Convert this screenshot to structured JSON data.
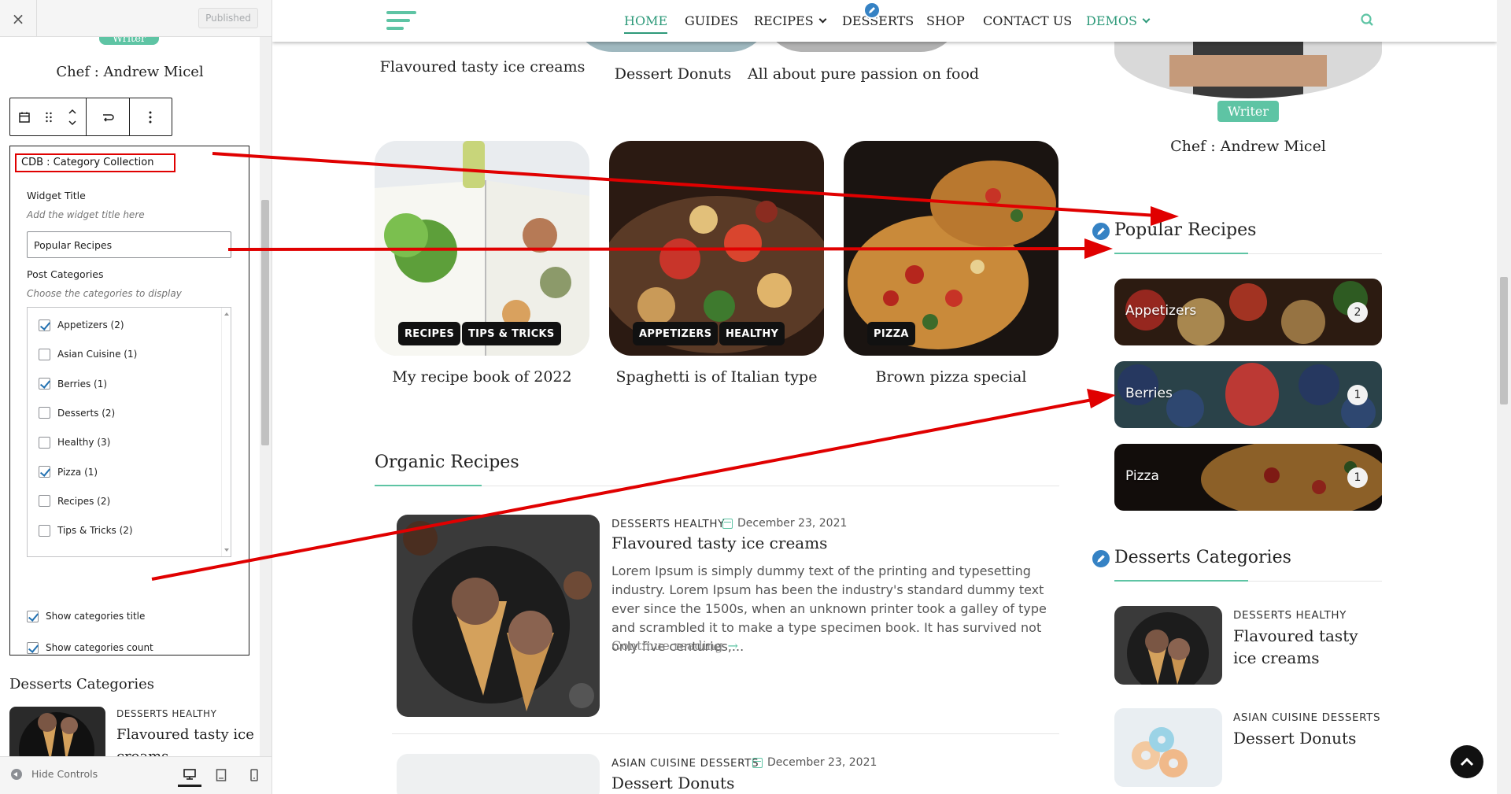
{
  "customizer": {
    "close_label": "×",
    "status_button": "Published",
    "writer_badge": "Writer",
    "chef_name": "Chef : Andrew Micel",
    "widget": {
      "name": "CDB : Category Collection",
      "widget_title_label": "Widget Title",
      "widget_title_help": "Add the widget title here",
      "widget_title_value": "Popular Recipes",
      "post_categories_label": "Post Categories",
      "post_categories_help": "Choose the categories to display",
      "categories": [
        {
          "label": "Appetizers (2)",
          "checked": true
        },
        {
          "label": "Asian Cuisine (1)",
          "checked": false
        },
        {
          "label": "Berries (1)",
          "checked": true
        },
        {
          "label": "Desserts (2)",
          "checked": false
        },
        {
          "label": "Healthy (3)",
          "checked": false
        },
        {
          "label": "Pizza (1)",
          "checked": true
        },
        {
          "label": "Recipes (2)",
          "checked": false
        },
        {
          "label": "Tips & Tricks (2)",
          "checked": false
        }
      ],
      "show_title_label": "Show categories title",
      "show_title_checked": true,
      "show_count_label": "Show categories count",
      "show_count_checked": true
    },
    "next_widget_title": "Desserts Categories",
    "next_post_cats": "DESSERTS  HEALTHY",
    "next_post_title": "Flavoured tasty ice creams",
    "hide_controls": "Hide Controls"
  },
  "nav": {
    "items": [
      "HOME",
      "GUIDES",
      "RECIPES",
      "DESSERTS",
      "SHOP",
      "CONTACT US",
      "DEMOS"
    ]
  },
  "top_row_titles": [
    "Flavoured tasty ice creams",
    "Dessert Donuts",
    "All about pure passion on food"
  ],
  "cards": [
    {
      "tags": [
        "RECIPES",
        "TIPS & TRICKS"
      ],
      "title": "My recipe book of 2022"
    },
    {
      "tags": [
        "APPETIZERS",
        "HEALTHY"
      ],
      "title": "Spaghetti is of Italian type"
    },
    {
      "tags": [
        "PIZZA"
      ],
      "title": "Brown pizza special"
    }
  ],
  "organic": {
    "title": "Organic Recipes",
    "posts": [
      {
        "cats": "DESSERTS HEALTHY",
        "date": "December 23, 2021",
        "title": "Flavoured tasty ice creams",
        "excerpt": "Lorem Ipsum is simply dummy text of the printing and typesetting industry. Lorem Ipsum has been the industry's standard dummy text ever since the 1500s, when an unknown printer took a galley of type and scrambled it to make a type specimen book. It has survived not only five centuries,...",
        "continue": "Continue reading"
      },
      {
        "cats": "ASIAN CUISINE DESSERTS",
        "date": "December 23, 2021",
        "title": "Dessert Donuts"
      }
    ]
  },
  "sidebar": {
    "writer_badge": "Writer",
    "chef_name": "Chef : Andrew Micel",
    "popular": {
      "title": "Popular Recipes",
      "categories": [
        {
          "name": "Appetizers",
          "count": "2"
        },
        {
          "name": "Berries",
          "count": "1"
        },
        {
          "name": "Pizza",
          "count": "1"
        }
      ]
    },
    "desserts": {
      "title": "Desserts Categories",
      "posts": [
        {
          "cats": "DESSERTS  HEALTHY",
          "title": "Flavoured tasty ice creams"
        },
        {
          "cats": "ASIAN CUISINE  DESSERTS",
          "title": "Dessert Donuts"
        }
      ]
    }
  },
  "colors": {
    "accent": "#5ec4a4",
    "accent_dark": "#2e9a7a",
    "annotation": "#e00000",
    "edit_pencil": "#3582c4"
  }
}
